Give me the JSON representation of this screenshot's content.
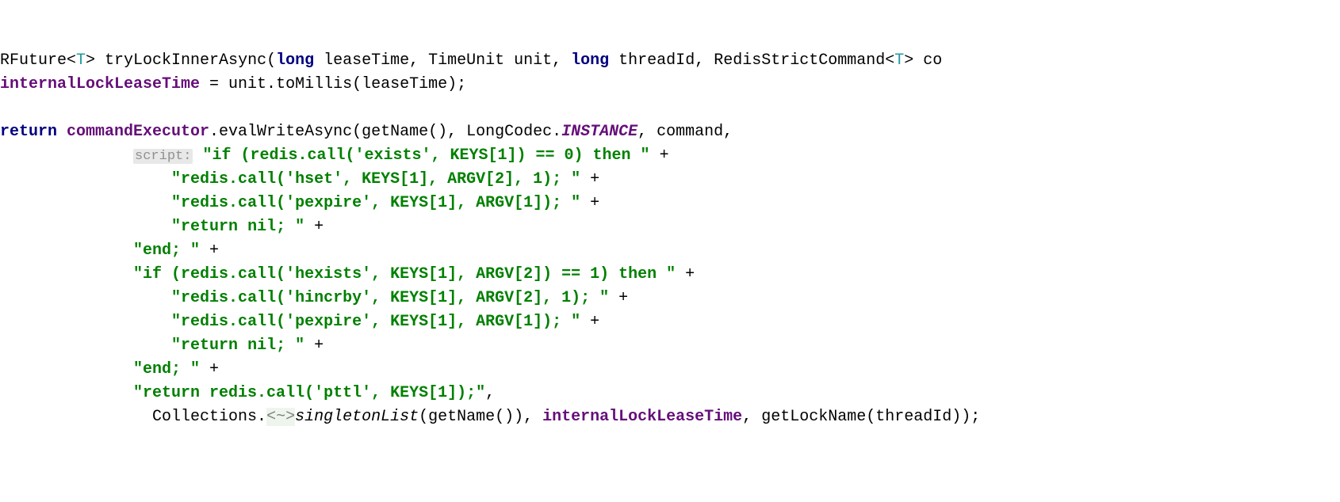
{
  "line1": {
    "prefix": "RFuture<",
    "generic": "T",
    "mid1": "> tryLockInnerAsync(",
    "kw_long1": "long",
    "p1": " leaseTime, TimeUnit unit, ",
    "kw_long2": "long",
    "p2": " threadId, RedisStrictCommand<",
    "generic2": "T",
    "p3": "> co"
  },
  "line2": {
    "field": "internalLockLeaseTime",
    "rest": " = unit.toMillis(leaseTime);"
  },
  "line3": {
    "kw_return": "return ",
    "field": "commandExecutor",
    "rest1": ".evalWriteAsync(getName(), LongCodec.",
    "instance": "INSTANCE",
    "rest2": ", command,"
  },
  "line4": {
    "hint": "script:",
    "str": "\"if (redis.call('exists', KEYS[1]) == 0) then \"",
    "plus": " +"
  },
  "line5": {
    "str": "\"redis.call('hset', KEYS[1], ARGV[2], 1); \"",
    "plus": " +"
  },
  "line6": {
    "str": "\"redis.call('pexpire', KEYS[1], ARGV[1]); \"",
    "plus": " +"
  },
  "line7": {
    "str": "\"return nil; \"",
    "plus": " +"
  },
  "line8": {
    "str": "\"end; \"",
    "plus": " +"
  },
  "line9": {
    "str": "\"if (redis.call('hexists', KEYS[1], ARGV[2]) == 1) then \"",
    "plus": " +"
  },
  "line10": {
    "str": "\"redis.call('hincrby', KEYS[1], ARGV[2], 1); \"",
    "plus": " +"
  },
  "line11": {
    "str": "\"redis.call('pexpire', KEYS[1], ARGV[1]); \"",
    "plus": " +"
  },
  "line12": {
    "str": "\"return nil; \"",
    "plus": " +"
  },
  "line13": {
    "str": "\"end; \"",
    "plus": " +"
  },
  "line14": {
    "str": "\"return redis.call('pttl', KEYS[1]);\"",
    "comma": ","
  },
  "line15": {
    "coll": "Collections.",
    "lambdaHint": "<~>",
    "singleton": "singletonList",
    "sig": "(getName()), ",
    "field": "internalLockLeaseTime",
    "rest": ", getLockName(threadId));"
  }
}
